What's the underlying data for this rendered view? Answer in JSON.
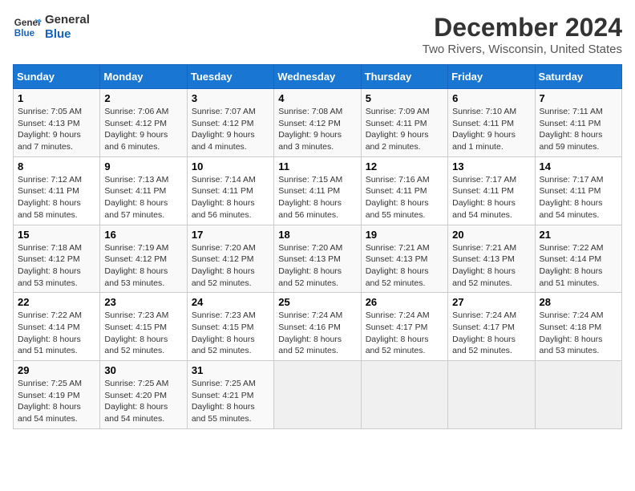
{
  "logo": {
    "line1": "General",
    "line2": "Blue"
  },
  "title": "December 2024",
  "subtitle": "Two Rivers, Wisconsin, United States",
  "days_of_week": [
    "Sunday",
    "Monday",
    "Tuesday",
    "Wednesday",
    "Thursday",
    "Friday",
    "Saturday"
  ],
  "weeks": [
    [
      {
        "day": "1",
        "sunrise": "Sunrise: 7:05 AM",
        "sunset": "Sunset: 4:13 PM",
        "daylight": "Daylight: 9 hours and 7 minutes."
      },
      {
        "day": "2",
        "sunrise": "Sunrise: 7:06 AM",
        "sunset": "Sunset: 4:12 PM",
        "daylight": "Daylight: 9 hours and 6 minutes."
      },
      {
        "day": "3",
        "sunrise": "Sunrise: 7:07 AM",
        "sunset": "Sunset: 4:12 PM",
        "daylight": "Daylight: 9 hours and 4 minutes."
      },
      {
        "day": "4",
        "sunrise": "Sunrise: 7:08 AM",
        "sunset": "Sunset: 4:12 PM",
        "daylight": "Daylight: 9 hours and 3 minutes."
      },
      {
        "day": "5",
        "sunrise": "Sunrise: 7:09 AM",
        "sunset": "Sunset: 4:11 PM",
        "daylight": "Daylight: 9 hours and 2 minutes."
      },
      {
        "day": "6",
        "sunrise": "Sunrise: 7:10 AM",
        "sunset": "Sunset: 4:11 PM",
        "daylight": "Daylight: 9 hours and 1 minute."
      },
      {
        "day": "7",
        "sunrise": "Sunrise: 7:11 AM",
        "sunset": "Sunset: 4:11 PM",
        "daylight": "Daylight: 8 hours and 59 minutes."
      }
    ],
    [
      {
        "day": "8",
        "sunrise": "Sunrise: 7:12 AM",
        "sunset": "Sunset: 4:11 PM",
        "daylight": "Daylight: 8 hours and 58 minutes."
      },
      {
        "day": "9",
        "sunrise": "Sunrise: 7:13 AM",
        "sunset": "Sunset: 4:11 PM",
        "daylight": "Daylight: 8 hours and 57 minutes."
      },
      {
        "day": "10",
        "sunrise": "Sunrise: 7:14 AM",
        "sunset": "Sunset: 4:11 PM",
        "daylight": "Daylight: 8 hours and 56 minutes."
      },
      {
        "day": "11",
        "sunrise": "Sunrise: 7:15 AM",
        "sunset": "Sunset: 4:11 PM",
        "daylight": "Daylight: 8 hours and 56 minutes."
      },
      {
        "day": "12",
        "sunrise": "Sunrise: 7:16 AM",
        "sunset": "Sunset: 4:11 PM",
        "daylight": "Daylight: 8 hours and 55 minutes."
      },
      {
        "day": "13",
        "sunrise": "Sunrise: 7:17 AM",
        "sunset": "Sunset: 4:11 PM",
        "daylight": "Daylight: 8 hours and 54 minutes."
      },
      {
        "day": "14",
        "sunrise": "Sunrise: 7:17 AM",
        "sunset": "Sunset: 4:11 PM",
        "daylight": "Daylight: 8 hours and 54 minutes."
      }
    ],
    [
      {
        "day": "15",
        "sunrise": "Sunrise: 7:18 AM",
        "sunset": "Sunset: 4:12 PM",
        "daylight": "Daylight: 8 hours and 53 minutes."
      },
      {
        "day": "16",
        "sunrise": "Sunrise: 7:19 AM",
        "sunset": "Sunset: 4:12 PM",
        "daylight": "Daylight: 8 hours and 53 minutes."
      },
      {
        "day": "17",
        "sunrise": "Sunrise: 7:20 AM",
        "sunset": "Sunset: 4:12 PM",
        "daylight": "Daylight: 8 hours and 52 minutes."
      },
      {
        "day": "18",
        "sunrise": "Sunrise: 7:20 AM",
        "sunset": "Sunset: 4:13 PM",
        "daylight": "Daylight: 8 hours and 52 minutes."
      },
      {
        "day": "19",
        "sunrise": "Sunrise: 7:21 AM",
        "sunset": "Sunset: 4:13 PM",
        "daylight": "Daylight: 8 hours and 52 minutes."
      },
      {
        "day": "20",
        "sunrise": "Sunrise: 7:21 AM",
        "sunset": "Sunset: 4:13 PM",
        "daylight": "Daylight: 8 hours and 52 minutes."
      },
      {
        "day": "21",
        "sunrise": "Sunrise: 7:22 AM",
        "sunset": "Sunset: 4:14 PM",
        "daylight": "Daylight: 8 hours and 51 minutes."
      }
    ],
    [
      {
        "day": "22",
        "sunrise": "Sunrise: 7:22 AM",
        "sunset": "Sunset: 4:14 PM",
        "daylight": "Daylight: 8 hours and 51 minutes."
      },
      {
        "day": "23",
        "sunrise": "Sunrise: 7:23 AM",
        "sunset": "Sunset: 4:15 PM",
        "daylight": "Daylight: 8 hours and 52 minutes."
      },
      {
        "day": "24",
        "sunrise": "Sunrise: 7:23 AM",
        "sunset": "Sunset: 4:15 PM",
        "daylight": "Daylight: 8 hours and 52 minutes."
      },
      {
        "day": "25",
        "sunrise": "Sunrise: 7:24 AM",
        "sunset": "Sunset: 4:16 PM",
        "daylight": "Daylight: 8 hours and 52 minutes."
      },
      {
        "day": "26",
        "sunrise": "Sunrise: 7:24 AM",
        "sunset": "Sunset: 4:17 PM",
        "daylight": "Daylight: 8 hours and 52 minutes."
      },
      {
        "day": "27",
        "sunrise": "Sunrise: 7:24 AM",
        "sunset": "Sunset: 4:17 PM",
        "daylight": "Daylight: 8 hours and 52 minutes."
      },
      {
        "day": "28",
        "sunrise": "Sunrise: 7:24 AM",
        "sunset": "Sunset: 4:18 PM",
        "daylight": "Daylight: 8 hours and 53 minutes."
      }
    ],
    [
      {
        "day": "29",
        "sunrise": "Sunrise: 7:25 AM",
        "sunset": "Sunset: 4:19 PM",
        "daylight": "Daylight: 8 hours and 54 minutes."
      },
      {
        "day": "30",
        "sunrise": "Sunrise: 7:25 AM",
        "sunset": "Sunset: 4:20 PM",
        "daylight": "Daylight: 8 hours and 54 minutes."
      },
      {
        "day": "31",
        "sunrise": "Sunrise: 7:25 AM",
        "sunset": "Sunset: 4:21 PM",
        "daylight": "Daylight: 8 hours and 55 minutes."
      },
      null,
      null,
      null,
      null
    ]
  ]
}
